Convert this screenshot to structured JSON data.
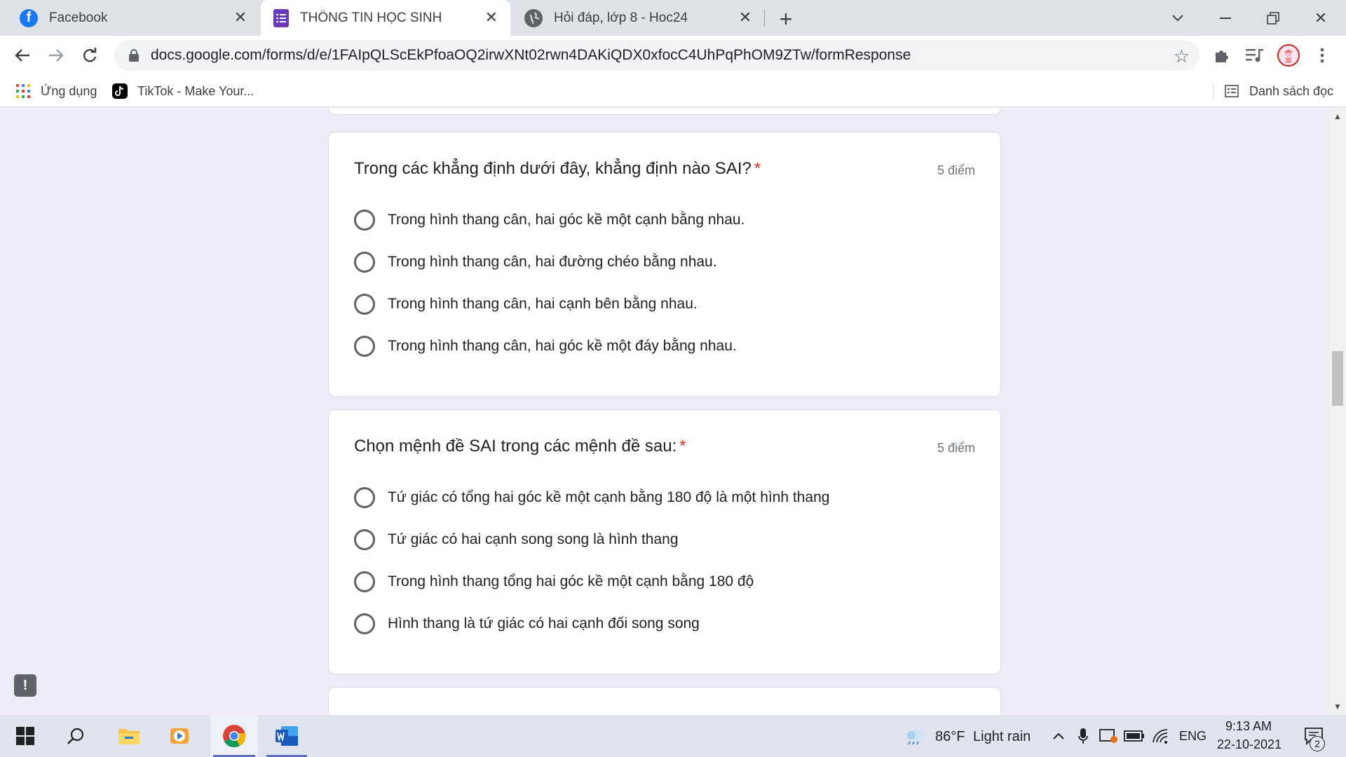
{
  "browser": {
    "tabs": [
      {
        "title": "Facebook",
        "icon": "facebook-icon",
        "active": false
      },
      {
        "title": "THÔNG TIN HỌC SINH",
        "icon": "google-forms-icon",
        "active": true
      },
      {
        "title": "Hỏi đáp, lớp 8 - Hoc24",
        "icon": "globe-icon",
        "active": false
      }
    ],
    "url": "docs.google.com/forms/d/e/1FAIpQLScEkPfoaOQ2irwXNt02rwn4DAKiQDX0xfocC4UhPqPhOM9ZTw/formResponse",
    "bookmarks": [
      {
        "label": "Ứng dụng",
        "icon": "apps-grid-icon"
      },
      {
        "label": "TikTok - Make Your...",
        "icon": "tiktok-icon"
      }
    ],
    "reading_list_label": "Danh sách đọc"
  },
  "form": {
    "questions": [
      {
        "title": "Trong các khẳng định dưới đây, khẳng định nào SAI?",
        "required_mark": "*",
        "points": "5 điểm",
        "options": [
          "Trong hình thang cân, hai góc kề một cạnh bằng nhau.",
          "Trong hình thang cân, hai đường chéo bằng nhau.",
          "Trong hình thang cân, hai cạnh bên bằng nhau.",
          "Trong hình thang cân, hai góc kề một đáy bằng nhau."
        ]
      },
      {
        "title": "Chọn mệnh đề SAI trong các mệnh đề sau:",
        "required_mark": "*",
        "points": "5 điểm",
        "options": [
          "Tứ giác có tổng hai góc kề một cạnh bằng 180 độ là một hình thang",
          "Tứ giác có hai cạnh song song là hình thang",
          "Trong hình thang tổng hai góc kề một cạnh bằng 180 độ",
          "Hình thang là tứ giác có hai cạnh đối song song"
        ]
      }
    ]
  },
  "taskbar": {
    "weather": "86°F",
    "weather_desc": "Light rain",
    "language": "ENG",
    "time": "9:13 AM",
    "date": "22-10-2021",
    "notification_count": "2"
  },
  "colors": {
    "form_background": "#f0ebf8",
    "required": "#d93025",
    "forms_purple": "#673ab7",
    "facebook_blue": "#1877f2"
  }
}
